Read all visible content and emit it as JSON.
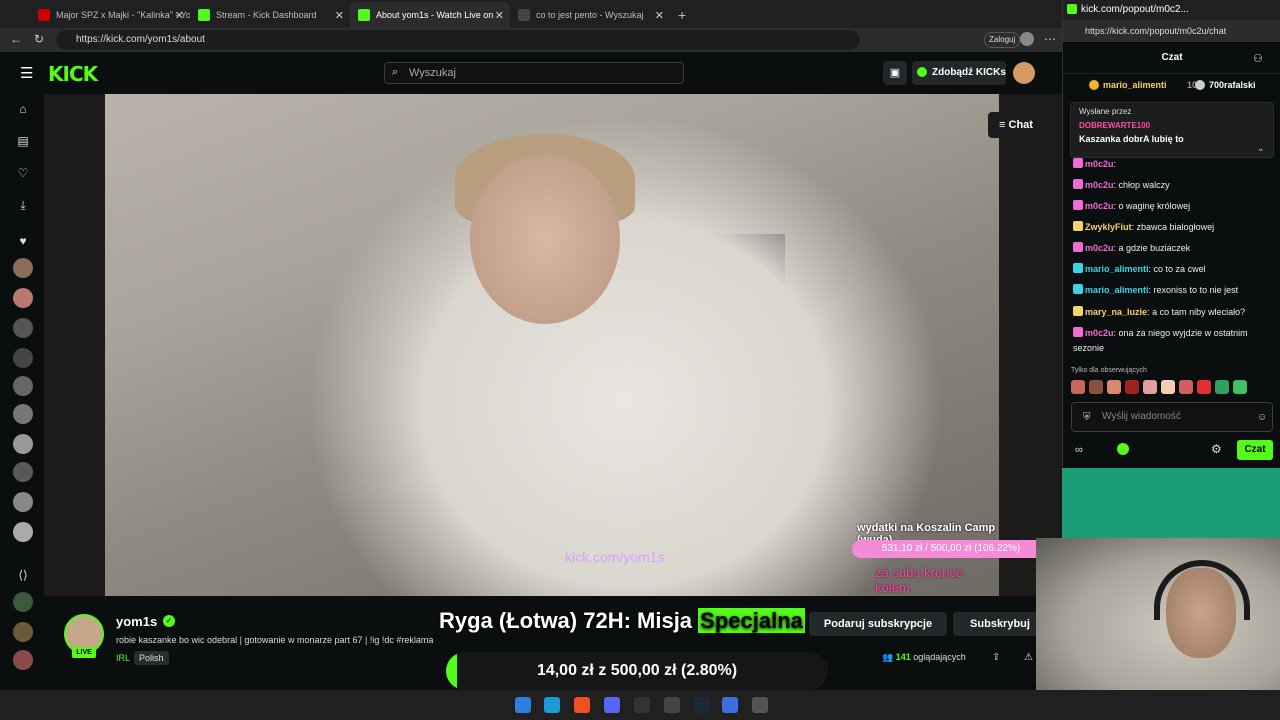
{
  "browser": {
    "tabs": [
      {
        "label": "Major SPZ x Majki - \"Kalinka\" - Yo",
        "color": "#cc0000"
      },
      {
        "label": "Stream - Kick Dashboard",
        "color": "#53fc18"
      },
      {
        "label": "About yom1s - Watch Live on",
        "color": "#53fc18"
      },
      {
        "label": "co to jest pento - Wyszukaj",
        "color": "#444444"
      }
    ],
    "url": "https://kick.com/yom1s/about",
    "login_label": "Zaloguj"
  },
  "kick": {
    "logo": "KICK",
    "search_placeholder": "Wyszukaj",
    "get_kicks": "Zdobądź KICKs",
    "chat_button": "Chat"
  },
  "video": {
    "overlay_goal_title": "wydatki na Koszalin Camp (wuda)",
    "overlay_goal_value": "531,10 zł / 500,00 zł (106.22%)",
    "overlay_pink_text": "za suba krence kolem",
    "overlay_url": "kick.com/yom1s"
  },
  "channel": {
    "name": "yom1s",
    "live_badge": "LIVE",
    "title": "robie kaszanke bo wic odebral | gotowanie w monarze part 67 | !ig !dc #reklama",
    "category": "IRL",
    "language": "Polish",
    "overlay_title_pre": "Ryga (Łotwa) 72H: Misja ",
    "overlay_title_highlight": "Specjalna",
    "goal_text": "14,00 zł z 500,00 zł (2.80%)",
    "goal_progress": 0.028,
    "gift_sub": "Podaruj subskrypcje",
    "subscribe": "Subskrybuj",
    "viewers_count": "141",
    "viewers_label": "oglądających"
  },
  "popout": {
    "window_title": "kick.com/popout/m0c2...",
    "url": "https://kick.com/popout/m0c2u/chat",
    "header": "Czat",
    "gifters": [
      {
        "name": "mario_alimenti",
        "count": "10"
      },
      {
        "name": "700rafalski",
        "count": ""
      }
    ],
    "pinned": {
      "label": "Wysłane przez",
      "user": "DOBREWARTE100",
      "text": "Kaszanka dobrA lubię to"
    },
    "messages": [
      {
        "user": "m0c2u",
        "text": "",
        "color": "#f06bd3"
      },
      {
        "user": "m0c2u",
        "text": "chłop walczy",
        "color": "#f06bd3"
      },
      {
        "user": "m0c2u",
        "text": "o waginę królowej",
        "color": "#f06bd3"
      },
      {
        "user": "ZwyklyFiut",
        "text": "zbawca bialogłowej",
        "color": "#f3d36b"
      },
      {
        "user": "m0c2u",
        "text": "a gdzie buziaczek",
        "color": "#f06bd3"
      },
      {
        "user": "mario_alimenti",
        "text": "co to za cwel",
        "color": "#3ad3e8"
      },
      {
        "user": "mario_alimenti",
        "text": "rexoniss to to nie jest",
        "color": "#3ad3e8"
      },
      {
        "user": "mary_na_luzie",
        "text": "a co tam niby wleciało?",
        "color": "#f3d36b"
      },
      {
        "user": "m0c2u",
        "text": "ona za niego wyjdzie w ostatnim sezonie",
        "color": "#f06bd3"
      }
    ],
    "followers_only": "Tylko dla obserwujących",
    "input_placeholder": "Wyślij wiadomość",
    "send_label": "Czat"
  }
}
